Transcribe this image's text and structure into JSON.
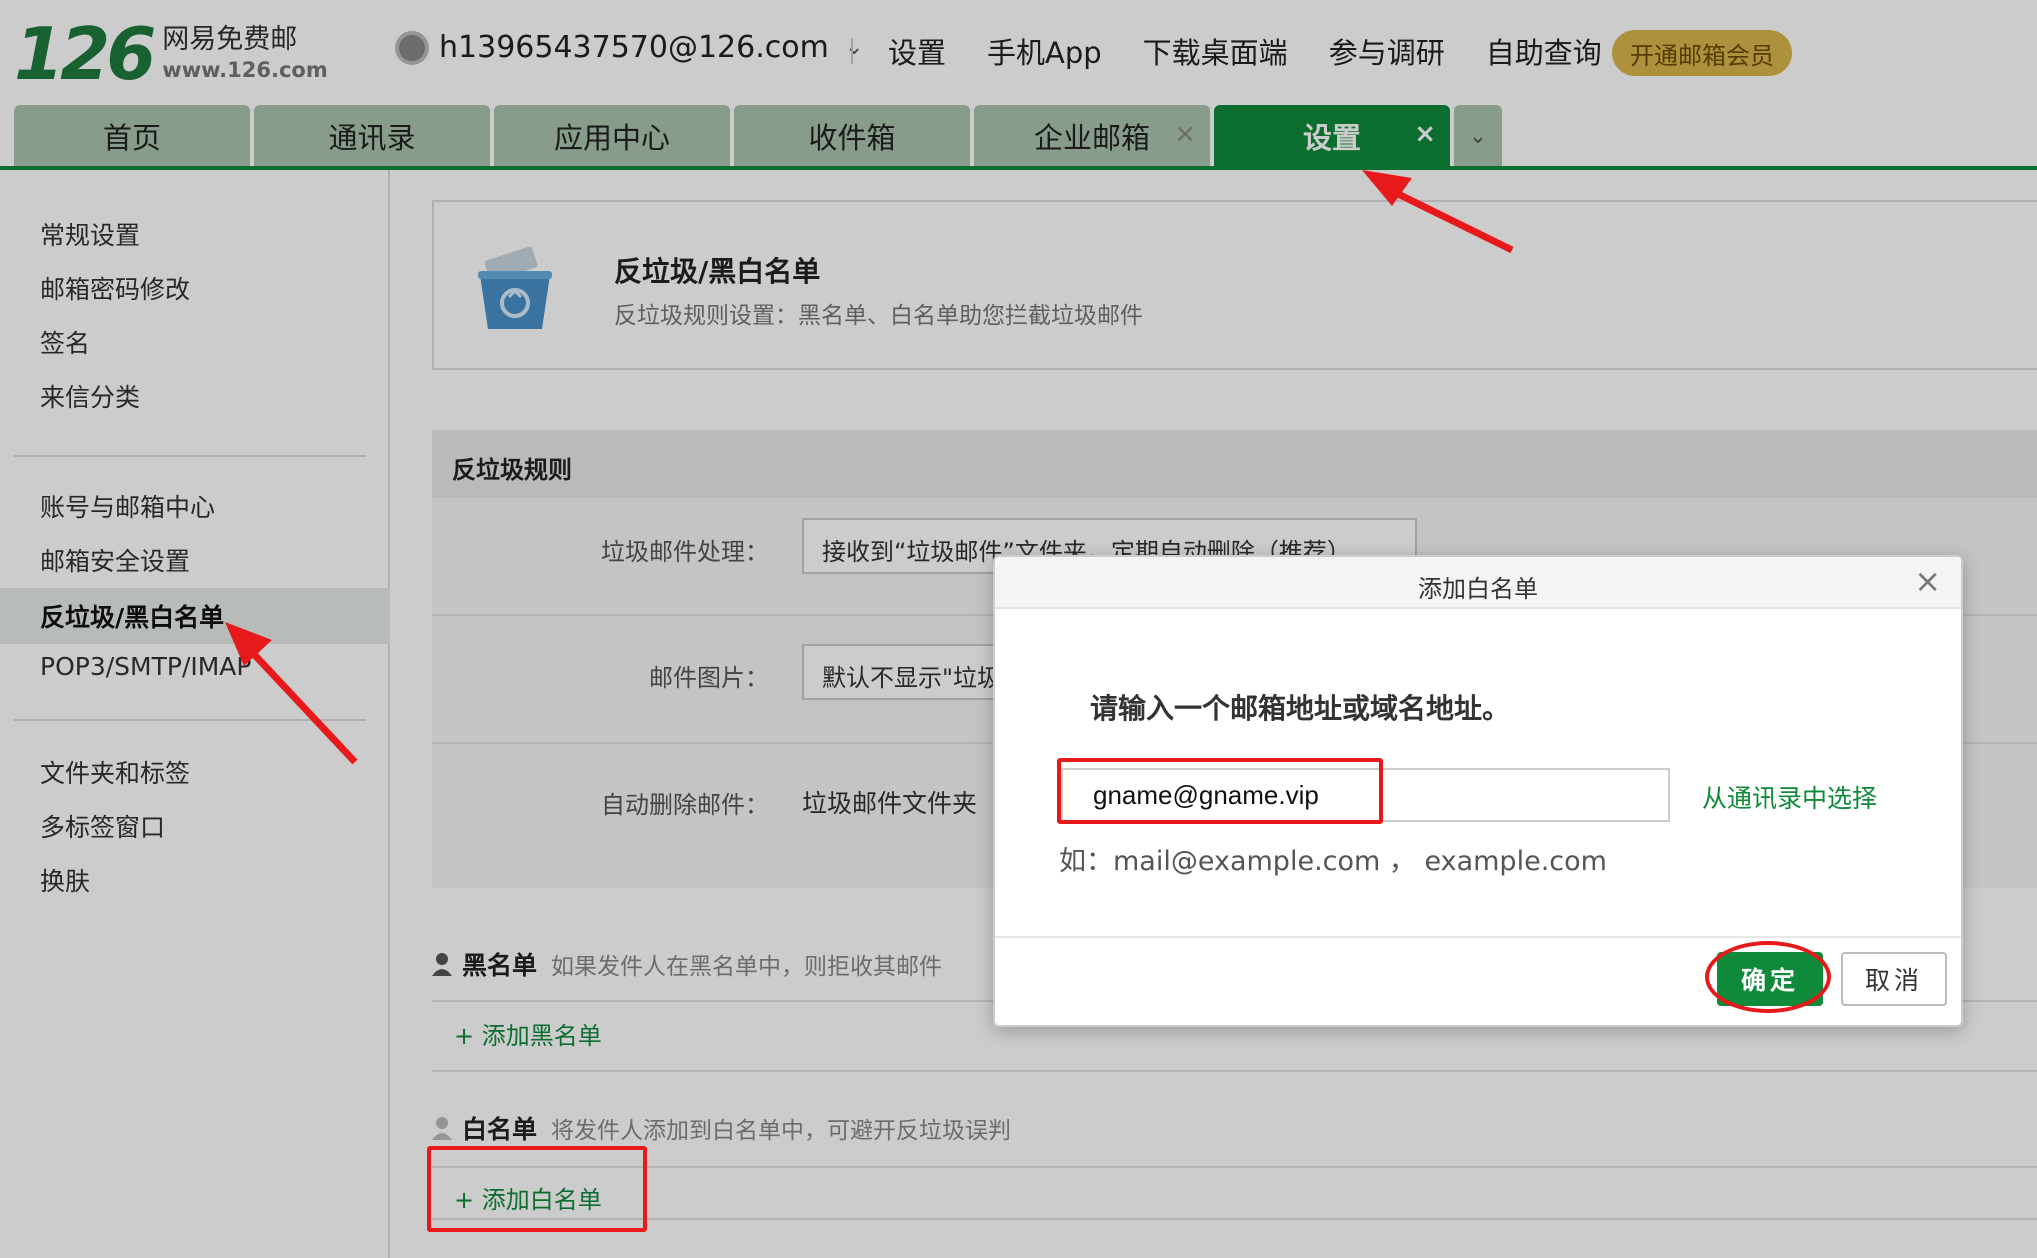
{
  "header": {
    "logo_number": "126",
    "logo_name": "网易免费邮",
    "logo_url": "www.126.com",
    "account": "h13965437570@126.com",
    "nav": [
      "设置",
      "手机App",
      "下载桌面端",
      "参与调研",
      "自助查询"
    ],
    "vip_button": "开通邮箱会员"
  },
  "tabs": [
    {
      "label": "首页"
    },
    {
      "label": "通讯录"
    },
    {
      "label": "应用中心"
    },
    {
      "label": "收件箱"
    },
    {
      "label": "企业邮箱",
      "closable": true
    },
    {
      "label": "设置",
      "closable": true,
      "active": true
    }
  ],
  "sidebar": {
    "group1": [
      "常规设置",
      "邮箱密码修改",
      "签名",
      "来信分类"
    ],
    "group2": [
      "账号与邮箱中心",
      "邮箱安全设置",
      "反垃圾/黑白名单",
      "POP3/SMTP/IMAP"
    ],
    "group3": [
      "文件夹和标签",
      "多标签窗口",
      "换肤"
    ],
    "active": "反垃圾/黑白名单"
  },
  "card": {
    "title": "反垃圾/黑白名单",
    "subtitle": "反垃圾规则设置：黑名单、白名单助您拦截垃圾邮件"
  },
  "rules": {
    "heading": "反垃圾规则",
    "junk_label": "垃圾邮件处理：",
    "junk_value": "接收到“垃圾邮件”文件夹，定期自动删除（推荐）",
    "image_label": "邮件图片：",
    "image_value": "默认不显示\"垃圾邮件\"中的图片",
    "autodelete_label": "自动删除邮件：",
    "autodelete_value": "垃圾邮件文件夹"
  },
  "blacklist": {
    "title": "黑名单",
    "desc": "如果发件人在黑名单中，则拒收其邮件",
    "add": "+ 添加黑名单"
  },
  "whitelist": {
    "title": "白名单",
    "desc": "将发件人添加到白名单中，可避开反垃圾误判",
    "add": "+ 添加白名单"
  },
  "dialog": {
    "title": "添加白名单",
    "prompt": "请输入一个邮箱地址或域名地址。",
    "input_value": "gname@gname.vip",
    "contacts_link": "从通讯录中选择",
    "example": "如：mail@example.com ， example.com",
    "ok": "确定",
    "cancel": "取消",
    "close": "×"
  },
  "colors": {
    "brand_green": "#0f8a3a",
    "tab_inactive": "#a9c4ae",
    "annotation_red": "#e8191b",
    "vip_gold": "#d9b64d"
  }
}
